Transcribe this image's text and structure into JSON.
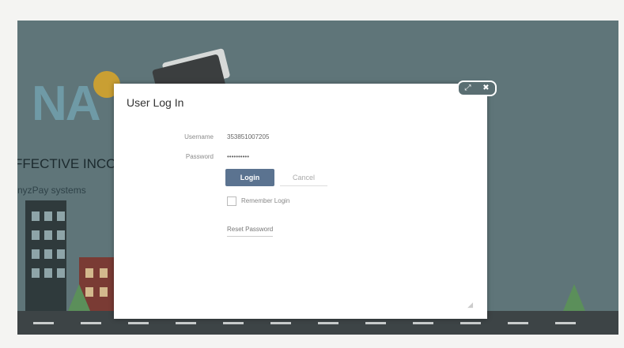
{
  "background": {
    "logo_text": "NA",
    "headline": "FFECTIVE INCO",
    "subtext": "nyzPay systems"
  },
  "dialog": {
    "title": "User Log In",
    "username_label": "Username",
    "username_value": "353851007205",
    "password_label": "Password",
    "password_value": "••••••••••",
    "login_button": "Login",
    "cancel_button": "Cancel",
    "remember_label": "Remember Login",
    "reset_link": "Reset Password",
    "resize_icon": "resize-grip-icon"
  },
  "window_controls": {
    "expand_icon": "⤢",
    "close_icon": "✖"
  },
  "colors": {
    "backdrop": "#5f7579",
    "login_button": "#5b7390",
    "dialog_bg": "#ffffff"
  }
}
